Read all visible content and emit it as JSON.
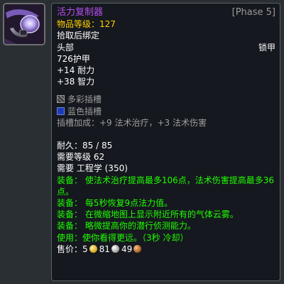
{
  "icon": {
    "name": "goggles-icon"
  },
  "item": {
    "name": "活力复制器",
    "phase": "[Phase 5]",
    "item_level_label": "物品等级：",
    "item_level_value": "127",
    "bind": "拾取后绑定",
    "slot": "头部",
    "armor_type": "锁甲",
    "armor": "726护甲",
    "stats": [
      "+14 耐力",
      "+38 智力"
    ],
    "sockets": [
      {
        "icon": "prismatic-socket-icon",
        "label": "多彩插槽"
      },
      {
        "icon": "blue-socket-icon",
        "label": "蓝色插槽"
      }
    ],
    "socket_bonus": "插槽加成：+9 法术治疗，+3 法术伤害",
    "durability": "耐久：85 / 85",
    "required_level": "需要等级 62",
    "required_skill": "需要 工程学 (350)",
    "equip_effects": [
      "装备：  使法术治疗提高最多106点，法术伤害提高最多36点。",
      "装备：  每5秒恢复9点法力值。",
      "装备：  在微缩地图上显示附近所有的气体云雾。",
      "装备：  略微提高你的潜行侦测能力。"
    ],
    "use_effect": "使用：使你看得更远。（3秒 冷却）",
    "sell_label": "售价：",
    "sell_price": {
      "gold": "5",
      "silver": "81",
      "copper": "49"
    }
  },
  "colors": {
    "epic": "#b64dee",
    "gold_text": "#ffd100",
    "green_text": "#1eff00",
    "white_text": "#ffffff",
    "background": "#15181e"
  }
}
